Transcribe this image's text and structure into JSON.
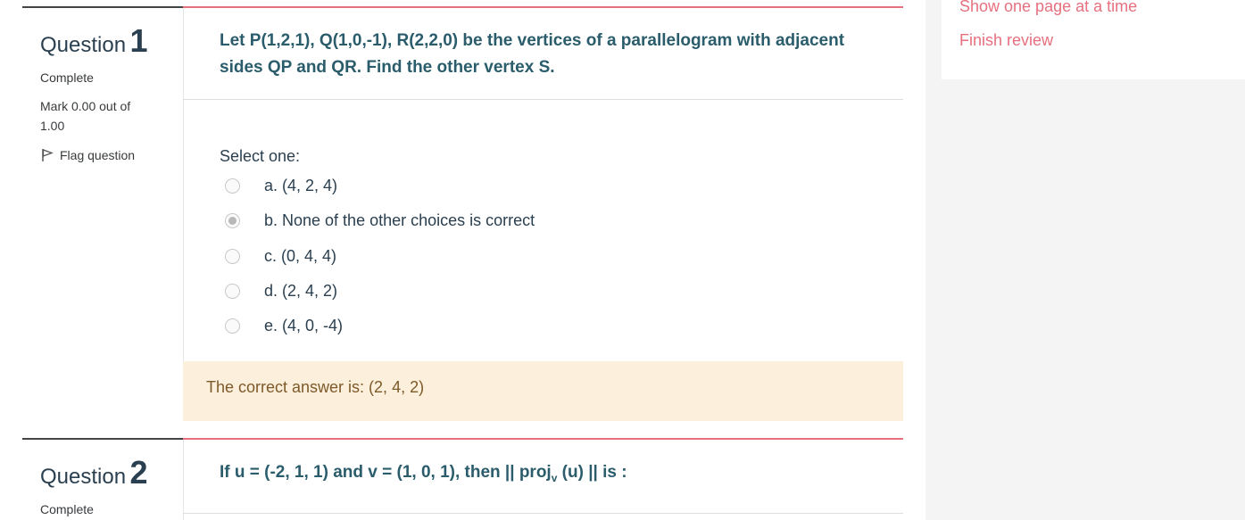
{
  "questions": [
    {
      "label": "Question",
      "number": "1",
      "state": "Complete",
      "grade": "Mark 0.00 out of 1.00",
      "flag_label": "Flag question",
      "text": "Let P(1,2,1), Q(1,0,-1), R(2,2,0) be the vertices of a parallelogram with adjacent sides QP and QR. Find the other vertex S.",
      "prompt": "Select one:",
      "options": [
        {
          "label": "a. (4, 2, 4)",
          "checked": false
        },
        {
          "label": "b. None of the other choices is correct",
          "checked": true
        },
        {
          "label": "c. (0, 4, 4)",
          "checked": false
        },
        {
          "label": "d. (2, 4, 2)",
          "checked": false
        },
        {
          "label": "e. (4, 0, -4)",
          "checked": false
        }
      ],
      "feedback": "The correct answer is: (2, 4, 2)"
    },
    {
      "label": "Question",
      "number": "2",
      "state": "Complete",
      "text_before": "If u = (-2, 1, 1) and v = (1, 0, 1), then || proj",
      "text_sub": "v",
      "text_after": " (u) || is :"
    }
  ],
  "nav": {
    "show_one_page": "Show one page at a time",
    "finish_review": "Finish review"
  },
  "colors": {
    "accent": "#e7707e",
    "heading": "#2a5c6b",
    "feedback_bg": "#fcefdc"
  }
}
